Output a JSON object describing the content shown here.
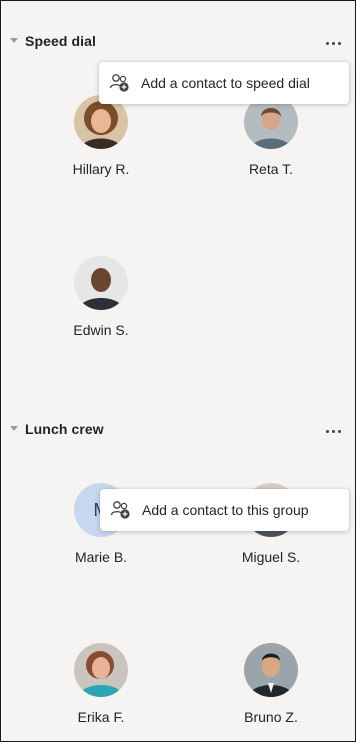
{
  "speed_dial": {
    "title": "Speed dial",
    "tooltip": "Add a contact to speed dial",
    "contacts": [
      {
        "name": "Hillary R.",
        "avatar": "photo-woman-curly-hair"
      },
      {
        "name": "Reta T.",
        "avatar": "photo-woman-office"
      },
      {
        "name": "Edwin S.",
        "avatar": "photo-man-smiling"
      }
    ]
  },
  "lunch_crew": {
    "title": "Lunch crew",
    "tooltip": "Add a contact to this group",
    "contacts": [
      {
        "name": "Marie B.",
        "avatar": "initial-avatar",
        "initial": "M"
      },
      {
        "name": "Miguel S.",
        "avatar": "photo-man"
      },
      {
        "name": "Erika F.",
        "avatar": "photo-woman-teal-top"
      },
      {
        "name": "Bruno Z.",
        "avatar": "photo-man-suit"
      }
    ]
  },
  "icons": {
    "section_toggle": "chevron-down-icon",
    "more_options": "more-options-icon",
    "add_contact": "add-contact-icon"
  },
  "colors": {
    "background": "#f5f4f2",
    "text": "#242424",
    "initial_avatar_bg": "#c7d7ee"
  }
}
